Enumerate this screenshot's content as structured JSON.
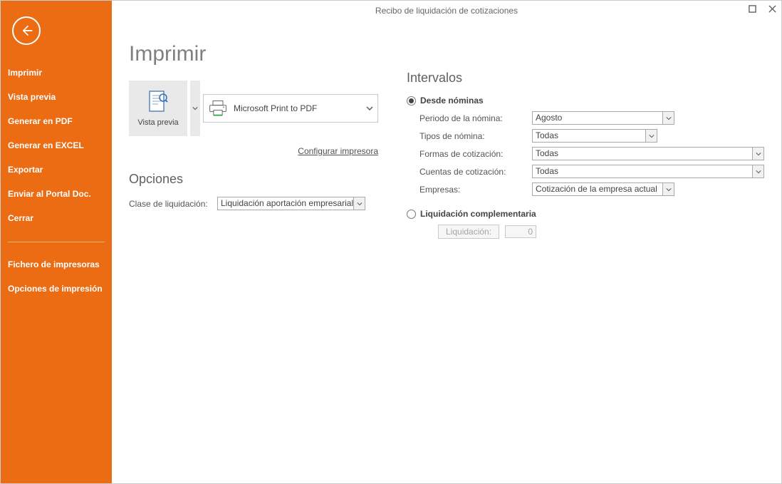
{
  "window": {
    "title": "Recibo de liquidación de cotizaciones"
  },
  "sidebar": {
    "items": [
      "Imprimir",
      "Vista previa",
      "Generar en PDF",
      "Generar en EXCEL",
      "Exportar",
      "Enviar al Portal Doc.",
      "Cerrar"
    ],
    "extra": [
      "Fichero de impresoras",
      "Opciones de impresión"
    ]
  },
  "page": {
    "title": "Imprimir",
    "preview_label": "Vista previa",
    "printer": "Microsoft Print to PDF",
    "configure_link": "Configurar impresora"
  },
  "opciones": {
    "heading": "Opciones",
    "clase_label": "Clase de liquidación:",
    "clase_value": "Liquidación aportación empresarial s"
  },
  "intervalos": {
    "heading": "Intervalos",
    "desde_label": "Desde nóminas",
    "periodo": {
      "label": "Periodo de la nómina:",
      "value": "Agosto"
    },
    "tipos": {
      "label": "Tipos de nómina:",
      "value": "Todas"
    },
    "formas": {
      "label": "Formas de cotización:",
      "value": "Todas"
    },
    "cuentas": {
      "label": "Cuentas de cotización:",
      "value": "Todas"
    },
    "empresas": {
      "label": "Empresas:",
      "value": "Cotización de la empresa actual"
    },
    "liq_comp_label": "Liquidación complementaria",
    "liq_btn": "Liquidación:",
    "liq_val": "0"
  }
}
